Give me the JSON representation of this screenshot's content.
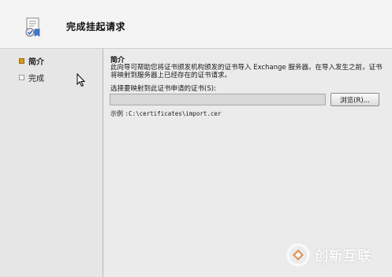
{
  "header": {
    "title": "完成挂起请求",
    "icon": "certificate-wizard-icon"
  },
  "nav": {
    "items": [
      {
        "label": "简介",
        "active": true
      },
      {
        "label": "完成",
        "active": false
      }
    ]
  },
  "main": {
    "section_title": "简介",
    "description": "此向导可帮助您将证书颁发机构颁发的证书导入 Exchange 服务器。在导入发生之前，证书将映射到服务器上已经存在的证书请求。",
    "field_label": "选择要映射到此证书申请的证书(S):",
    "path_value": "",
    "browse_label": "浏览(R)...",
    "example_prefix": "示例",
    "example_path": ":C:\\certificates\\import.cer"
  },
  "watermark": {
    "brand": "创新互联",
    "sub": "CHUANG XIN HU LIAN"
  },
  "colors": {
    "active_nav_marker": "#d79a1a",
    "background": "#e6e6e6"
  }
}
